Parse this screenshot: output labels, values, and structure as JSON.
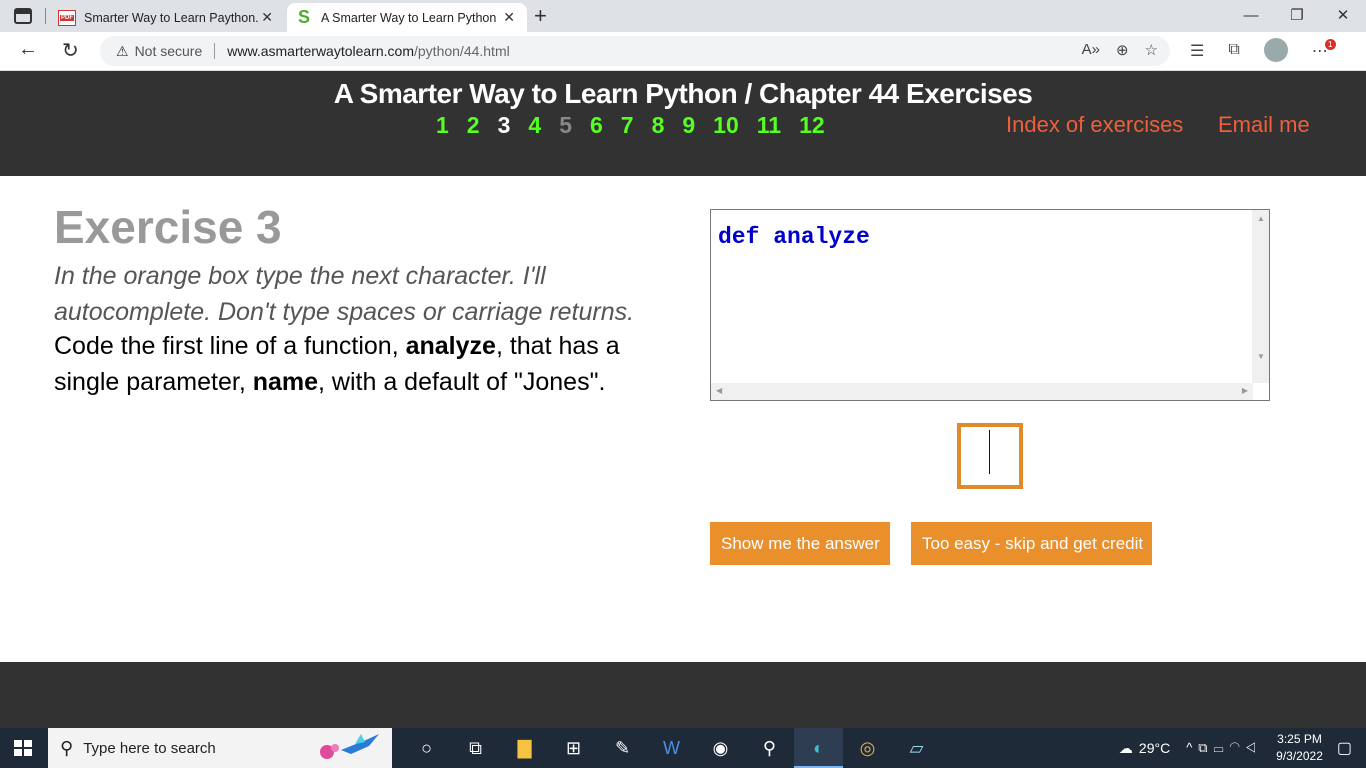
{
  "browser": {
    "tabs": [
      {
        "title": "Smarter Way to Learn Paython.pc",
        "favicon": "pdf-icon"
      },
      {
        "title": "A Smarter Way to Learn Python -",
        "favicon": "s-logo-icon"
      }
    ],
    "address": {
      "security": "Not secure",
      "host": "www.asmarterwaytolearn.com",
      "path": "/python/44.html"
    },
    "notification_badge": "1"
  },
  "header": {
    "title": "A Smarter Way to Learn Python / Chapter 44 Exercises",
    "exercise_numbers": [
      {
        "label": "1",
        "state": "available"
      },
      {
        "label": "2",
        "state": "available"
      },
      {
        "label": "3",
        "state": "current"
      },
      {
        "label": "4",
        "state": "available"
      },
      {
        "label": "5",
        "state": "done"
      },
      {
        "label": "6",
        "state": "available"
      },
      {
        "label": "7",
        "state": "available"
      },
      {
        "label": "8",
        "state": "available"
      },
      {
        "label": "9",
        "state": "available"
      },
      {
        "label": "10",
        "state": "available"
      },
      {
        "label": "11",
        "state": "available"
      },
      {
        "label": "12",
        "state": "available"
      }
    ],
    "index_link": "Index of exercises",
    "email_link": "Email me"
  },
  "exercise": {
    "heading": "Exercise 3",
    "instructions": "In the orange box type the next character. I'll autocomplete. Don't type spaces or carriage returns.",
    "task_parts": {
      "p1": "Code the first line of a function, ",
      "b1": "analyze",
      "p2": ", that has a single parameter, ",
      "b2": "name",
      "p3": ", with a default of \"Jones\"."
    },
    "code": "def analyze",
    "answer_value": "",
    "show_answer_button": "Show me the answer",
    "skip_button": "Too easy - skip and get credit"
  },
  "taskbar": {
    "search_placeholder": "Type here to search",
    "temperature": "29°C",
    "time": "3:25 PM",
    "date": "9/3/2022"
  },
  "colors": {
    "header_bg": "#323232",
    "exercise_available": "#55ff20",
    "exercise_done": "#888888",
    "link": "#ef5f3a",
    "button": "#e98f2b",
    "code": "#0000cc"
  }
}
